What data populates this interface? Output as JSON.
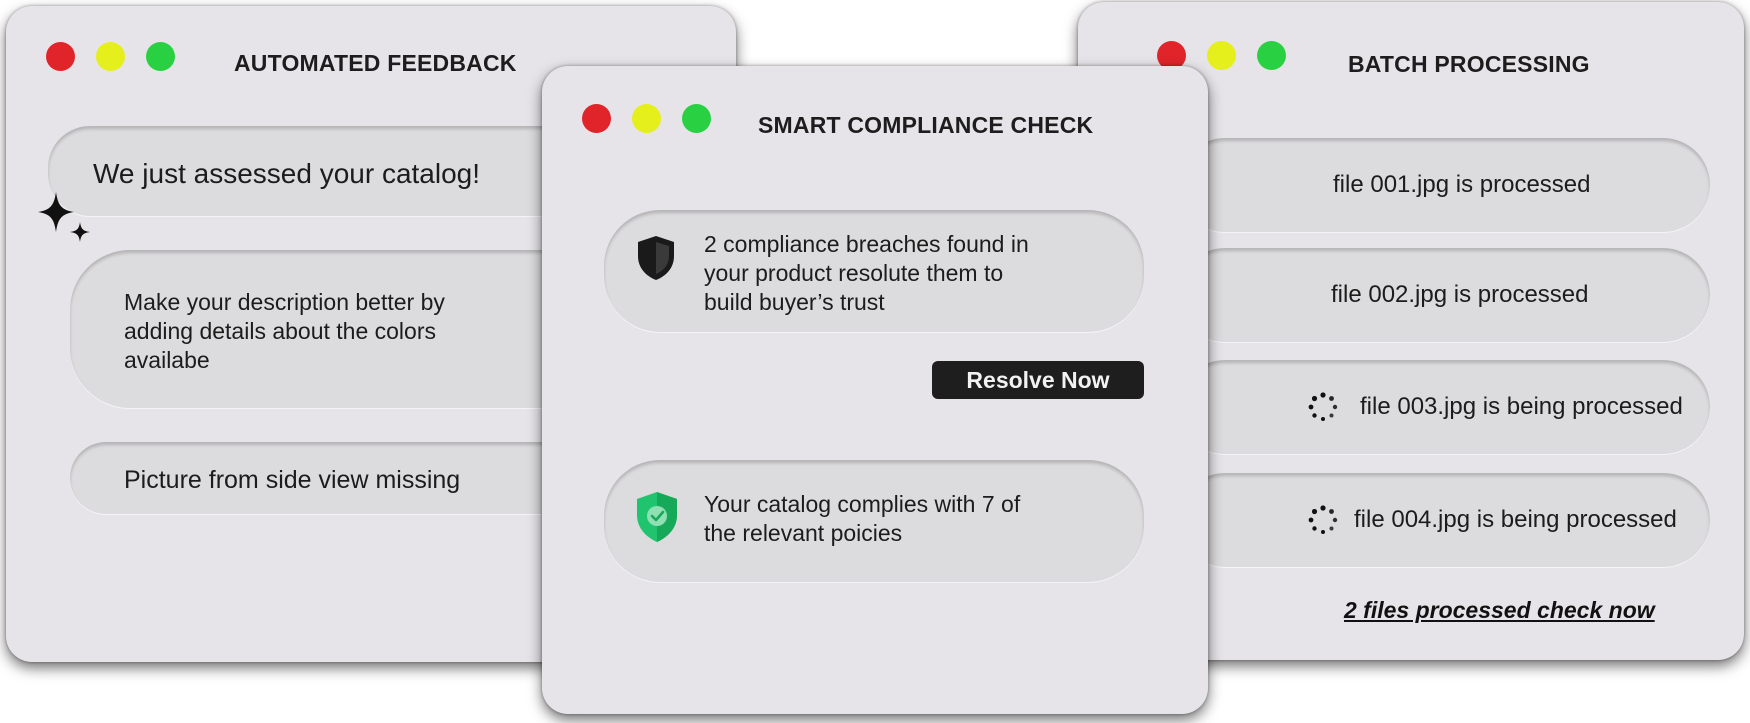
{
  "colors": {
    "close": "#e0242a",
    "minimize": "#e4ef1c",
    "maximize": "#29d142",
    "window_bg": "#e6e4e8",
    "pill_bg": "#dcdbdd",
    "button_bg": "#1e1e1e",
    "shield_green": "#21c46e"
  },
  "feedback": {
    "title": "AUTOMATED FEEDBACK",
    "headline": "We just assessed your catalog!",
    "suggestion_1": [
      "Make your description better by",
      "adding details about the colors",
      "availabe"
    ],
    "suggestion_2": "Picture from side view missing"
  },
  "compliance": {
    "title": "SMART COMPLIANCE CHECK",
    "breach_text": [
      "2 compliance breaches found in",
      "your product resolute them to",
      "build buyer’s trust"
    ],
    "breach_icon": "shield-icon",
    "resolve_label": "Resolve Now",
    "ok_text": [
      "Your catalog complies with 7 of",
      "the relevant poicies"
    ],
    "ok_icon": "shield-check-icon"
  },
  "batch": {
    "title": "BATCH PROCESSING",
    "files": [
      {
        "label": "file 001.jpg is processed",
        "status": "processed"
      },
      {
        "label": "file 002.jpg is processed",
        "status": "processed"
      },
      {
        "label": "file 003.jpg is being processed",
        "status": "processing"
      },
      {
        "label": "file 004.jpg is being processed",
        "status": "processing"
      }
    ],
    "summary_link": "2 files processed check now"
  }
}
